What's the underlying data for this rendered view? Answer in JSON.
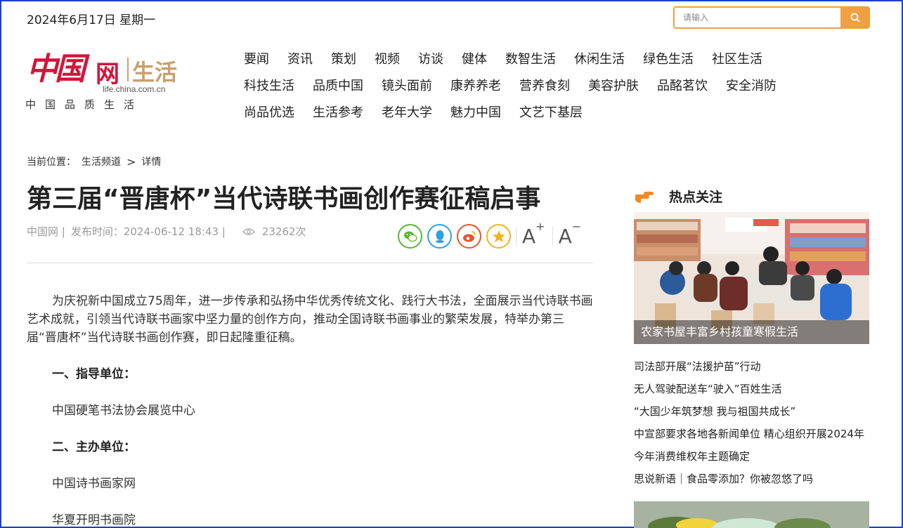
{
  "header": {
    "date": "2024年6月17日 星期一",
    "search_placeholder": "请输入"
  },
  "logo": {
    "brand_cn": "中国",
    "brand_wang": "网",
    "brand_section": "生活",
    "url": "life.china.com.cn",
    "slogan": "中国品质生活"
  },
  "nav": {
    "row1": [
      "要闻",
      "资讯",
      "策划",
      "视频",
      "访谈",
      "健体",
      "数智生活",
      "休闲生活",
      "绿色生活",
      "社区生活"
    ],
    "row2": [
      "科技生活",
      "品质中国",
      "镜头面前",
      "康养养老",
      "营养食刻",
      "美容护肤",
      "品酩茗饮",
      "安全消防"
    ],
    "row3": [
      "尚品优选",
      "生活参考",
      "老年大学",
      "魅力中国",
      "文艺下基层"
    ]
  },
  "breadcrumb": {
    "prefix": "当前位置：",
    "channel": "生活频道",
    "sep": ">",
    "current": "详情"
  },
  "article": {
    "title": "第三届“晋唐杯”当代诗联书画创作赛征稿启事",
    "source": "中国网 |",
    "publish": "发布时间：2024-06-12 18:43 |",
    "views": "23262次",
    "lead": "为庆祝新中国成立75周年，进一步传承和弘扬中华优秀传统文化、践行大书法，全面展示当代诗联书画艺术成就，引领当代诗联书画家中坚力量的创作方向，推动全国诗联书画事业的繁荣发展，特举办第三届“晋唐杯”当代诗联书画创作赛，即日起隆重征稿。",
    "h1": "一、指导单位：",
    "p1": "中国硬笔书法协会展览中心",
    "h2": "二、主办单位：",
    "p2": "中国诗书画家网",
    "p3": "华夏开明书画院"
  },
  "share": {
    "font_increase": "A",
    "font_increase_sup": "+",
    "font_decrease": "A",
    "font_decrease_sup": "−"
  },
  "sidebar": {
    "heading": "热点关注",
    "feature_caption": "农家书屋丰富乡村孩童寒假生活",
    "items": [
      "司法部开展“法援护苗”行动",
      "无人驾驶配送车“驶入”百姓生活",
      "“大国少年筑梦想 我与祖国共成长”",
      "中宣部要求各地各新闻单位 精心组织开展2024年",
      "今年消费维权年主题确定",
      "思说新语｜食品零添加？你被忽悠了吗"
    ]
  },
  "colors": {
    "accent": "#f0a040",
    "brand_red": "#d4143a",
    "brand_gold": "#c9a06a",
    "wechat": "#5cb531",
    "qq": "#2aa3e0",
    "weibo": "#e8542c",
    "qzone": "#f2b31c"
  }
}
